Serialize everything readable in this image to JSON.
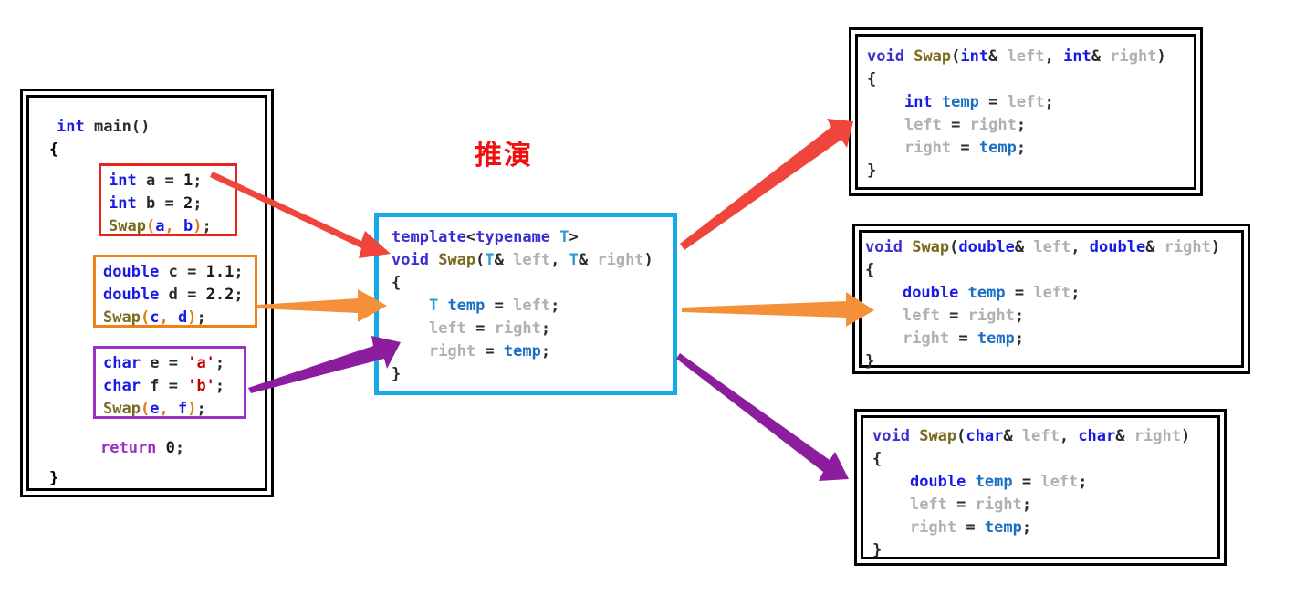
{
  "caption": {
    "text": "推演"
  },
  "colors": {
    "red": "#e8231c",
    "orange": "#f08018",
    "purple": "#9b30c8",
    "cyan": "#15a9e8",
    "black": "#000000",
    "caption_red": "#f01010"
  },
  "main_program": {
    "title_line": "int main()",
    "open_brace": "{",
    "close_brace": "}",
    "return_line": "return 0;",
    "blocks": [
      {
        "accent": "red",
        "lines": [
          "int a = 1;",
          "int b = 2;",
          "Swap(a, b);"
        ]
      },
      {
        "accent": "orange",
        "lines": [
          "double c = 1.1;",
          "double d = 2.2;",
          "Swap(c, d);"
        ]
      },
      {
        "accent": "purple",
        "lines": [
          "char e = 'a';",
          "char f = 'b';",
          "Swap(e, f);"
        ]
      }
    ]
  },
  "template_box": {
    "accent": "cyan",
    "lines": [
      "template<typename T>",
      "void Swap(T& left, T& right)",
      "{",
      "    T temp = left;",
      "    left = right;",
      "    right = temp;",
      "}"
    ]
  },
  "instantiations": [
    {
      "accent": "red",
      "type": "int",
      "lines": [
        "void Swap(int& left, int& right)",
        "{",
        "    int temp = left;",
        "    left = right;",
        "    right = temp;",
        "}"
      ]
    },
    {
      "accent": "orange",
      "type": "double",
      "lines": [
        "void Swap(double& left, double& right)",
        "{",
        "    double temp = left;",
        "    left = right;",
        "    right = temp;",
        "}"
      ]
    },
    {
      "accent": "purple",
      "type": "char",
      "lines": [
        "void Swap(char& left, char& right)",
        "{",
        "    double temp = left;",
        "    left = right;",
        "    right = temp;",
        "}"
      ]
    }
  ],
  "arrows": [
    {
      "name": "int-call-to-template",
      "color": "#e8231c"
    },
    {
      "name": "double-call-to-template",
      "color": "#f08018"
    },
    {
      "name": "char-call-to-template",
      "color": "#9b30c8"
    },
    {
      "name": "template-to-int-instance",
      "color": "#e8231c"
    },
    {
      "name": "template-to-double-instance",
      "color": "#f08018"
    },
    {
      "name": "template-to-char-instance",
      "color": "#9b30c8"
    }
  ]
}
